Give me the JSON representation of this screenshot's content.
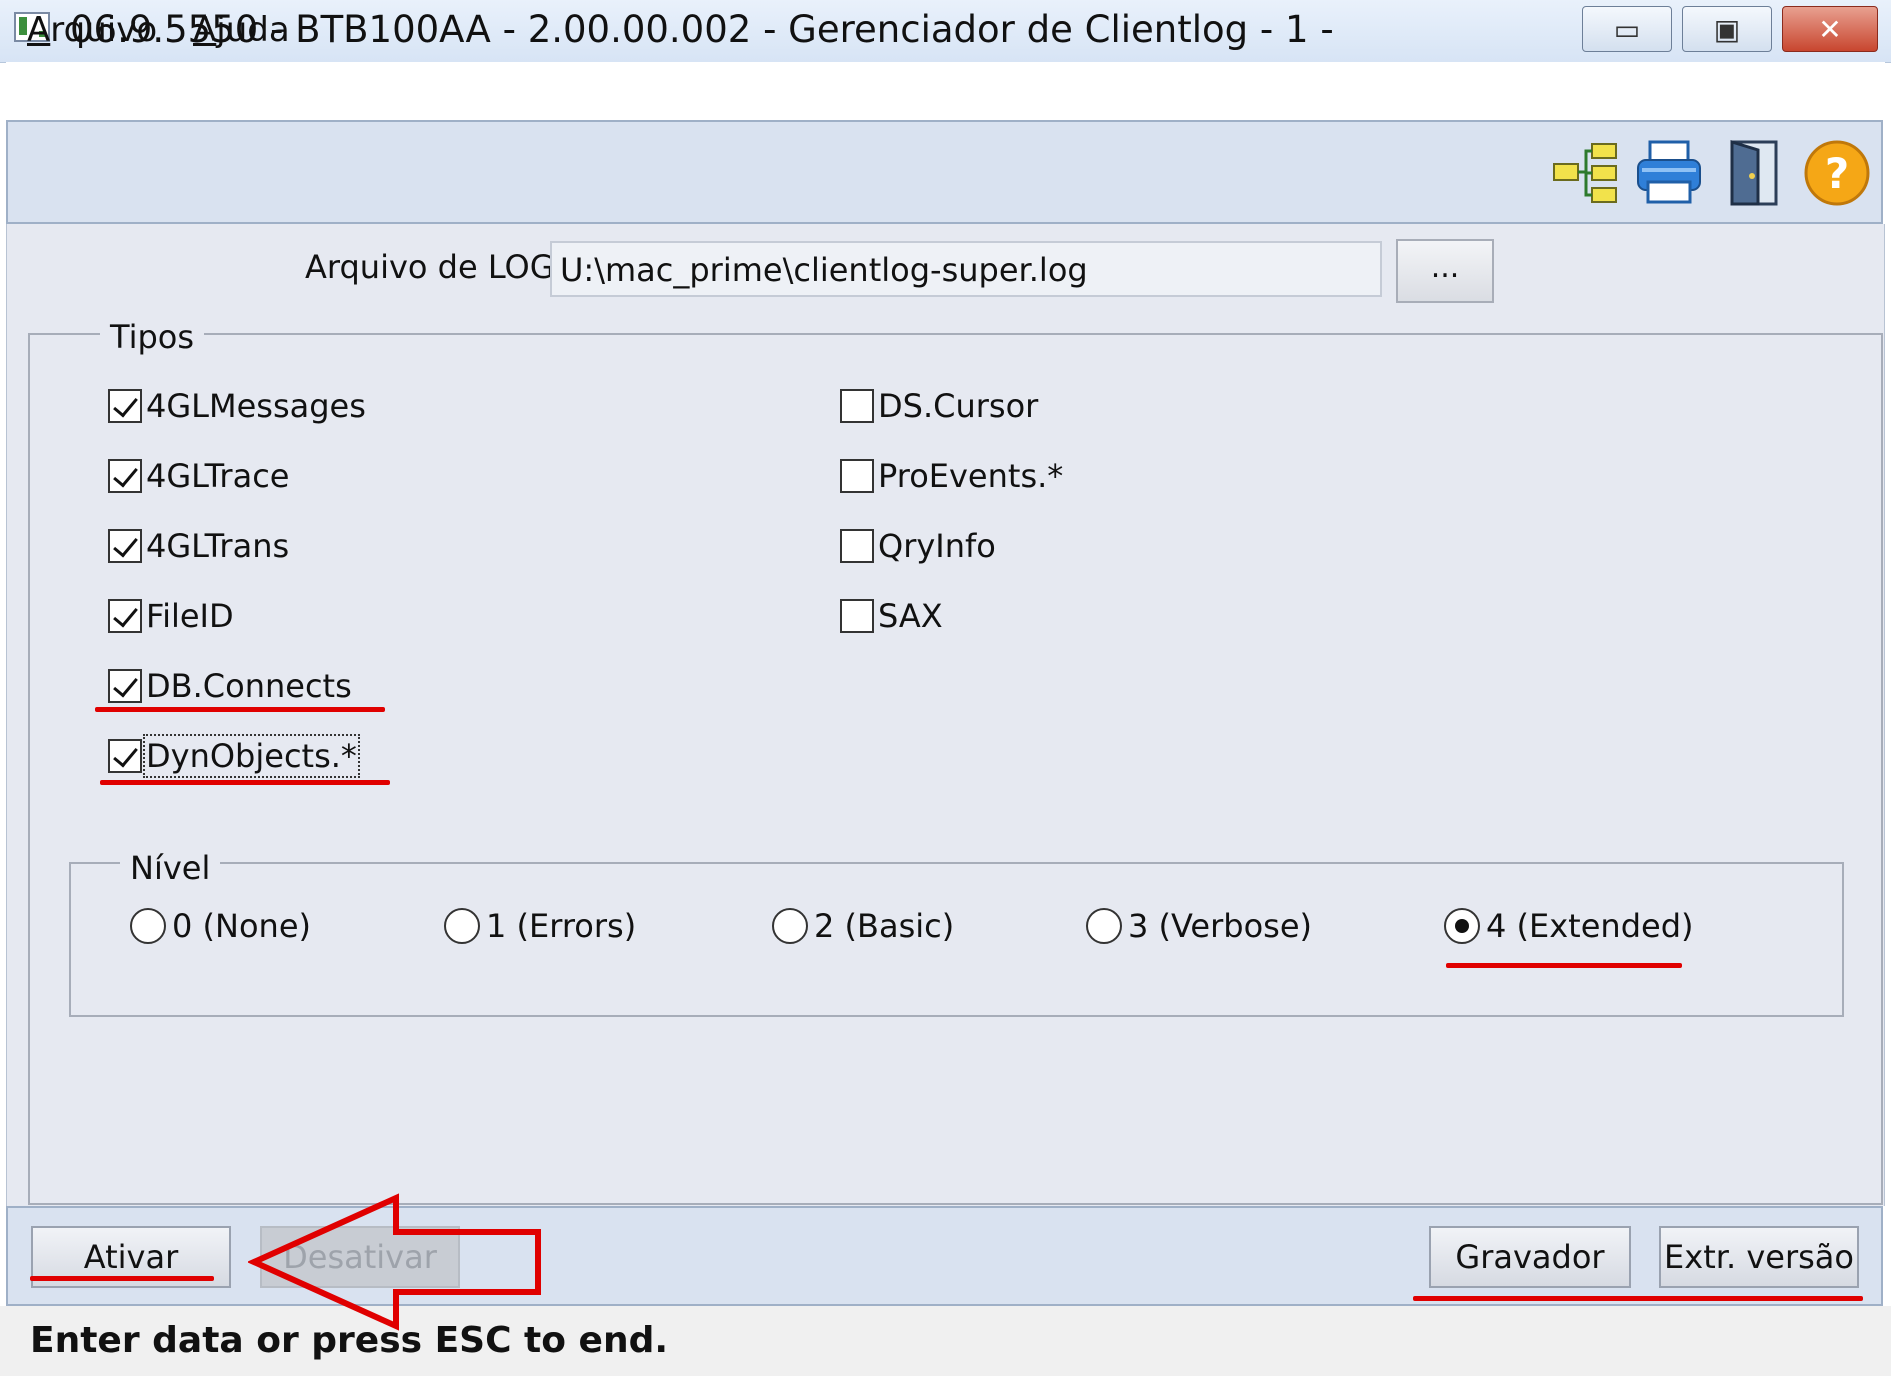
{
  "window": {
    "title": "06.9.5550 - BTB100AA - 2.00.00.002 - Gerenciador de Clientlog - 1 -",
    "minimize_glyph": "▭",
    "maximize_glyph": "▣",
    "close_glyph": "✕"
  },
  "menu": {
    "arquivo_mnemonic": "A",
    "arquivo_rest": "rquivo",
    "ajuda_mnemonic": "A",
    "ajuda_rest": "juda"
  },
  "toolbar": {
    "icons": [
      "tree-structure-icon",
      "printer-icon",
      "exit-door-icon",
      "help-icon"
    ],
    "help_glyph": "?"
  },
  "log": {
    "label": "Arquivo de LOG:",
    "value": "U:\\mac_prime\\clientlog-super.log",
    "browse_label": "..."
  },
  "tipos": {
    "title": "Tipos",
    "left": [
      {
        "label": "4GLMessages",
        "checked": true
      },
      {
        "label": "4GLTrace",
        "checked": true
      },
      {
        "label": "4GLTrans",
        "checked": true
      },
      {
        "label": "FileID",
        "checked": true
      },
      {
        "label": "DB.Connects",
        "checked": true
      },
      {
        "label": "DynObjects.*",
        "checked": true
      }
    ],
    "right": [
      {
        "label": "DS.Cursor",
        "checked": false
      },
      {
        "label": "ProEvents.*",
        "checked": false
      },
      {
        "label": "QryInfo",
        "checked": false
      },
      {
        "label": "SAX",
        "checked": false
      }
    ]
  },
  "nivel": {
    "title": "Nível",
    "options": [
      {
        "label": "0 (None)",
        "selected": false
      },
      {
        "label": "1 (Errors)",
        "selected": false
      },
      {
        "label": "2 (Basic)",
        "selected": false
      },
      {
        "label": "3 (Verbose)",
        "selected": false
      },
      {
        "label": "4 (Extended)",
        "selected": true
      }
    ]
  },
  "buttons": {
    "ativar": "Ativar",
    "desativar": "Desativar",
    "gravador": "Gravador",
    "extr_versao": "Extr. versão"
  },
  "status": {
    "text": "Enter data or press ESC to end."
  },
  "colors": {
    "annotation_red": "#e00000",
    "form_background": "#e6e9f1",
    "toolbar_background": "#d9e2f0"
  }
}
